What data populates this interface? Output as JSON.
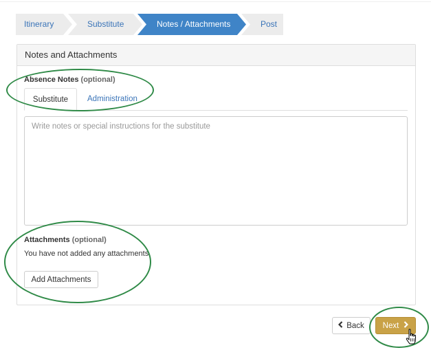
{
  "wizard": {
    "steps": [
      {
        "label": "Itinerary",
        "state": "done"
      },
      {
        "label": "Substitute",
        "state": "done"
      },
      {
        "label": "Notes / Attachments",
        "state": "active"
      },
      {
        "label": "Post",
        "state": "pending"
      }
    ]
  },
  "panel": {
    "title": "Notes and Attachments"
  },
  "absence_notes": {
    "label": "Absence Notes",
    "optional": "(optional)",
    "tabs": [
      {
        "label": "Substitute",
        "active": true
      },
      {
        "label": "Administration",
        "active": false
      }
    ],
    "placeholder": "Write notes or special instructions for the substitute",
    "value": ""
  },
  "attachments": {
    "label": "Attachments",
    "optional": "(optional)",
    "empty_text": "You have not added any attachments.",
    "add_button": "Add Attachments"
  },
  "footer": {
    "back_label": "Back",
    "next_label": "Next"
  },
  "colors": {
    "active_step": "#3f84c7",
    "inactive_step": "#ececec",
    "link": "#3a74b8",
    "next_button": "#c9a247",
    "highlight_ellipse": "#2f8a47"
  }
}
